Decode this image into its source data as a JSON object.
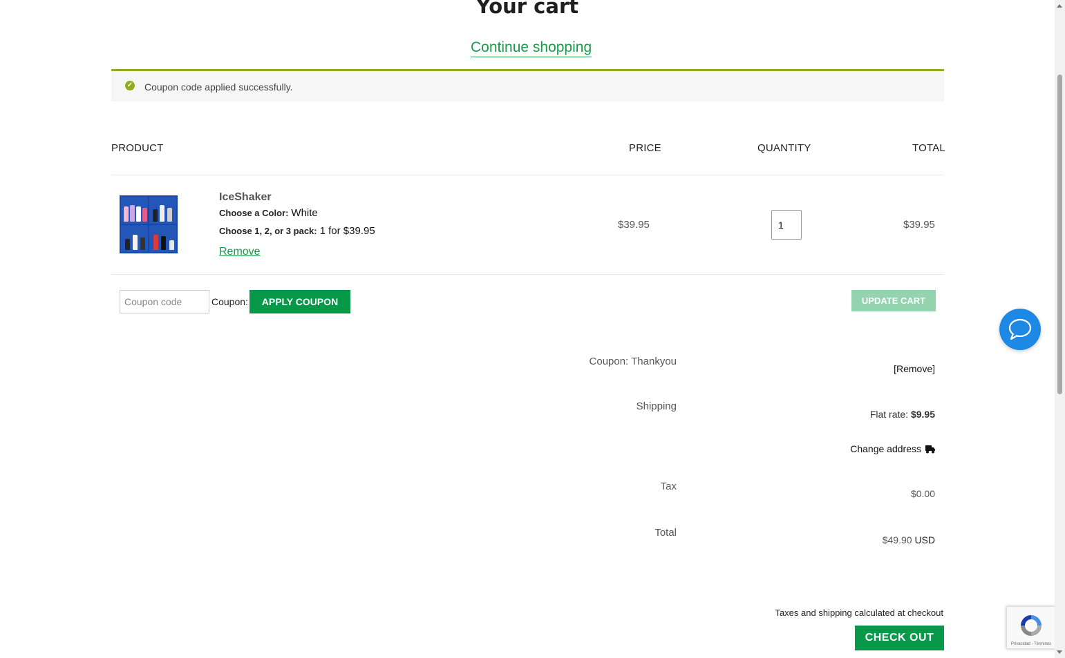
{
  "page": {
    "title": "Your cart",
    "continue_shopping": "Continue shopping"
  },
  "notice": {
    "message": "Coupon code applied successfully."
  },
  "table": {
    "headers": {
      "product": "PRODUCT",
      "price": "PRICE",
      "quantity": "QUANTITY",
      "total": "TOTAL"
    },
    "item": {
      "name": "IceShaker",
      "options": [
        {
          "label": "Choose a Color:",
          "value": "White"
        },
        {
          "label": "Choose 1, 2, or 3 pack:",
          "value": "1 for $39.95"
        }
      ],
      "remove_label": "Remove",
      "price": "$39.95",
      "quantity": "1",
      "total": "$39.95"
    }
  },
  "coupon": {
    "placeholder": "Coupon code",
    "label": "Coupon:",
    "apply_label": "APPLY COUPON",
    "update_label": "UPDATE CART"
  },
  "summary": {
    "coupon_label": "Coupon: Thankyou",
    "coupon_remove": "[Remove]",
    "shipping_label": "Shipping",
    "shipping_method": "Flat rate:",
    "shipping_amount": "$9.95",
    "change_address": "Change address",
    "tax_label": "Tax",
    "tax_value": "$0.00",
    "total_label": "Total",
    "total_value": "$49.90",
    "total_currency": "USD"
  },
  "footer": {
    "note": "Taxes and shipping calculated at checkout",
    "checkout_label": "CHECK OUT"
  },
  "widgets": {
    "chat_icon": "chat-bubble-icon",
    "recaptcha_text": "Privacidad - Términos"
  },
  "colors": {
    "accent_green": "#07984a",
    "notice_border": "#8fae1b",
    "chat_blue": "#1e88e5"
  }
}
